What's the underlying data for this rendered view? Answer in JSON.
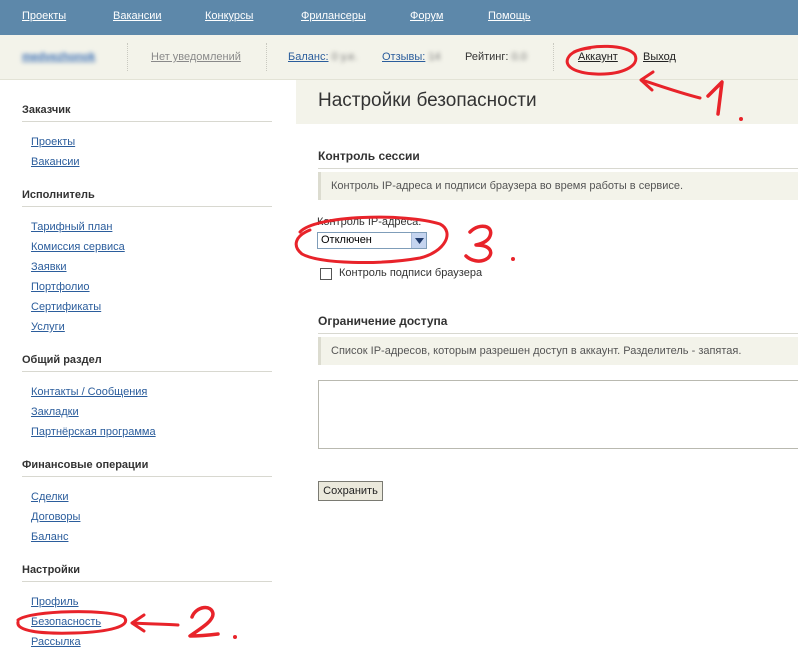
{
  "topnav": {
    "items": [
      "Проекты",
      "Вакансии",
      "Конкурсы",
      "Фрилансеры",
      "Форум",
      "Помощь"
    ]
  },
  "userbar": {
    "username": "medvezhonok",
    "notifications": "Нет уведомлений",
    "balance_label": "Баланс:",
    "balance_value": "0 у.е.",
    "reviews_label": "Отзывы:",
    "reviews_value": "14",
    "rating_label": "Рейтинг:",
    "rating_value": "0.0",
    "account": "Аккаунт",
    "logout": "Выход"
  },
  "sidebar": {
    "sections": [
      {
        "title": "Заказчик",
        "links": [
          "Проекты",
          "Вакансии"
        ]
      },
      {
        "title": "Исполнитель",
        "links": [
          "Тарифный план",
          "Комиссия сервиса",
          "Заявки",
          "Портфолио",
          "Сертификаты",
          "Услуги"
        ]
      },
      {
        "title": "Общий раздел",
        "links": [
          "Контакты / Сообщения",
          "Закладки",
          "Партнёрская программа"
        ]
      },
      {
        "title": "Финансовые операции",
        "links": [
          "Сделки",
          "Договоры",
          "Баланс"
        ]
      },
      {
        "title": "Настройки",
        "links": [
          "Профиль",
          "Безопасность",
          "Рассылка"
        ]
      }
    ]
  },
  "main": {
    "title": "Настройки безопасности",
    "session": {
      "title": "Контроль сессии",
      "hint": "Контроль IP-адреса и подписи браузера во время работы в сервисе.",
      "ip_label": "Контроль IP-адреса:",
      "ip_value": "Отключен",
      "browser_label": "Контроль подписи браузера",
      "browser_checked": false
    },
    "access": {
      "title": "Ограничение доступа",
      "hint": "Список IP-адресов, которым разрешен доступ в аккаунт. Разделитель - запятая.",
      "ip_list": ""
    },
    "save_label": "Сохранить"
  },
  "annotations": {
    "color": "#e8232a",
    "marks": [
      "1.",
      "2.",
      "3."
    ]
  }
}
